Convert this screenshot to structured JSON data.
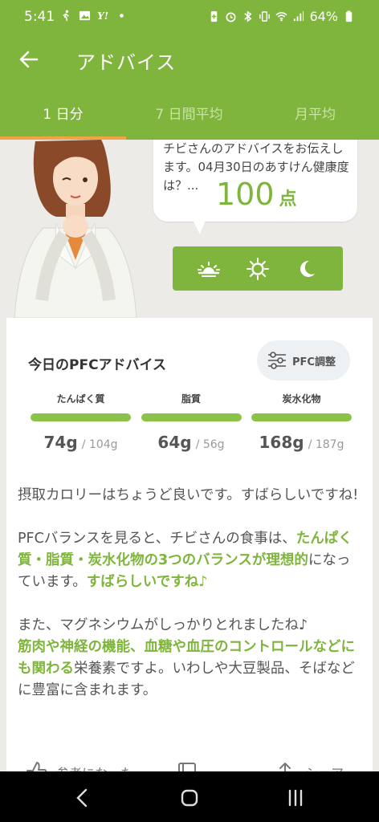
{
  "status_bar": {
    "time": "5:41",
    "battery": "64%",
    "icons": [
      "walk-icon",
      "image-icon",
      "yahoo-icon",
      "dot-icon",
      "battery-saver-icon",
      "alarm-icon",
      "bluetooth-icon",
      "vibrate-icon",
      "wifi-icon",
      "signal-icon",
      "battery-icon"
    ]
  },
  "appbar": {
    "title": "アドバイス",
    "back_icon": "arrow-back-icon"
  },
  "tabs": [
    {
      "label": "1 日分",
      "active": true
    },
    {
      "label": "7 日間平均",
      "active": false
    },
    {
      "label": "月平均",
      "active": false
    }
  ],
  "hero": {
    "bubble_text": "チビさんのアドバイスをお伝えします。04月30日のあすけん健康度は？...",
    "score": "100",
    "score_unit": "点",
    "time_icons": [
      "sunrise-icon",
      "sun-icon",
      "moon-icon"
    ]
  },
  "pfc": {
    "title": "今日のPFCアドバイス",
    "adjust_button": "PFC調整",
    "nutrients": [
      {
        "name": "たんぱく質",
        "value": "74",
        "unit": "g",
        "target": "104g",
        "fill": 1.0
      },
      {
        "name": "脂質",
        "value": "64",
        "unit": "g",
        "target": "56g",
        "fill": 1.0
      },
      {
        "name": "炭水化物",
        "value": "168",
        "unit": "g",
        "target": "187g",
        "fill": 1.0
      }
    ]
  },
  "advice": {
    "p1": "摂取カロリーはちょうど良いです。すばらしいですね!",
    "p2_a": "PFCバランスを見ると、チビさんの食事は、",
    "p2_hl1": "たんぱく質・脂質・炭水化物の3つのバランスが理想的",
    "p2_b": "になっています。",
    "p2_hl2": "すばらしいですね♪",
    "p3_a": "また、マグネシウムがしっかりとれましたね♪",
    "p3_hl": "筋肉や神経の機能、血糖や血圧のコントロールなどにも関わる",
    "p3_b": "栄養素ですよ。いわしや大豆製品、そばなどに豊富に含まれます。"
  },
  "actions": {
    "helpful": "参考になった",
    "share": "シェア"
  },
  "colors": {
    "accent": "#7fb53c",
    "tab_indicator": "#f0a640"
  }
}
